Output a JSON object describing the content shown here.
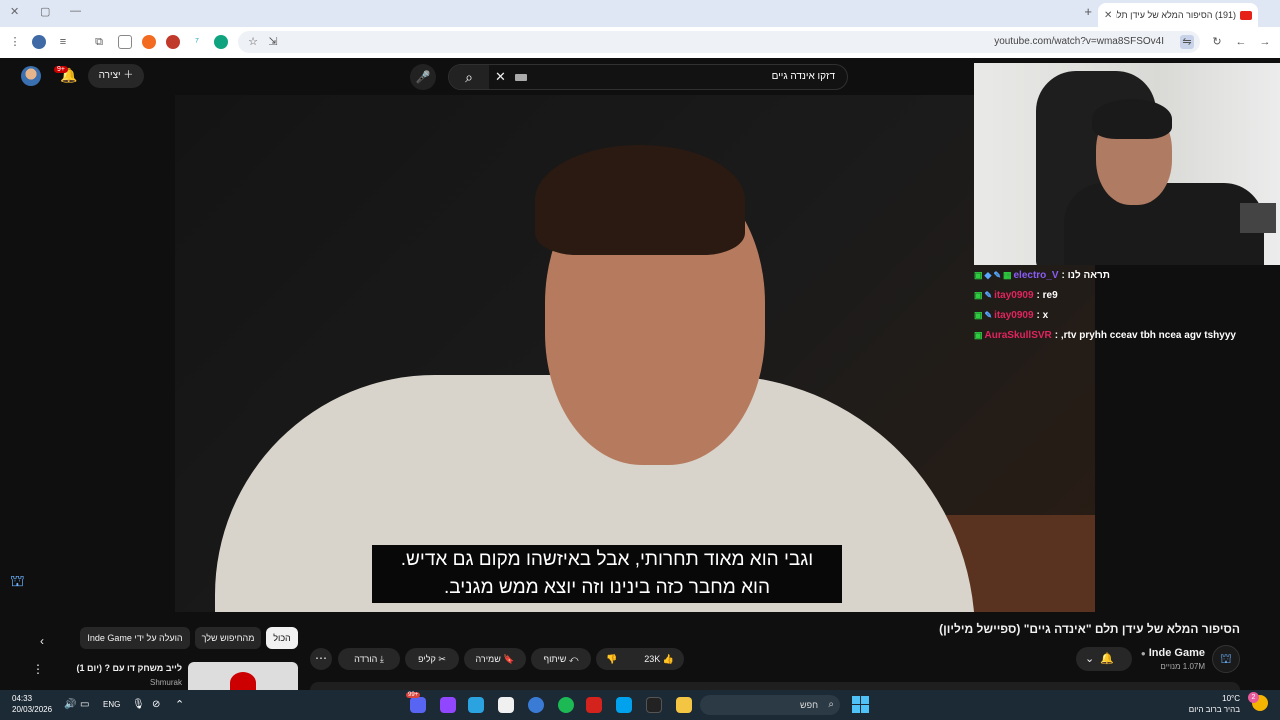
{
  "browser": {
    "tab_title": "(191) הסיפור המלא של עידן תלם",
    "url": "youtube.com/watch?v=wma8SFSOv4I",
    "new_tab": "+",
    "win_close": "✕",
    "win_restore": "▢",
    "win_minimize": "—"
  },
  "youtube": {
    "search_query": "דזקו אינדה גיים",
    "create_label": "יצירה",
    "notifications_badge": "9+",
    "video": {
      "subtitle_line1": "וגבי הוא מאוד תחרותי, אבל באיזשהו מקום גם אדיש.",
      "subtitle_line2": "הוא מחבר כזה בינינו וזה יוצא ממש מגניב."
    },
    "chat": [
      {
        "user": "electro_V",
        "message": "תראה לנו",
        "color": "#8a5cf6"
      },
      {
        "user": "itay0909",
        "message": "re9",
        "color": "#e0245e"
      },
      {
        "user": "itay0909",
        "message": "x",
        "color": "#e0245e"
      },
      {
        "user": "AuraSkullSVR",
        "message": ",rtv pryhh cceav tbh ncea agv tshyyy",
        "color": "#e0245e"
      }
    ],
    "title": "הסיפור המלא של עידן תלם \"אינדה גיים\" (ספיישל מיליון)",
    "channel_name": "Inde Game",
    "subscribers": "1.07M מנויים",
    "actions": {
      "likes": "23K",
      "share": "שיתוף",
      "save": "שמירה",
      "clip": "קליפ",
      "download": "הורדה"
    },
    "chips": [
      "הכול",
      "מהחיפוש שלך",
      "הועלה על ידי Inde Game"
    ],
    "recommendation": {
      "title": "לייב משחק דו עם ? (יום 1)",
      "channel": "Shmurak"
    }
  },
  "taskbar": {
    "time": "04:33",
    "date": "20/03/2026",
    "language": "ENG",
    "search_placeholder": "חפש",
    "temperature": "10°C",
    "weather_text": "בהיר ברוב היום",
    "weather_badge": "2",
    "app_badge": "99+"
  }
}
